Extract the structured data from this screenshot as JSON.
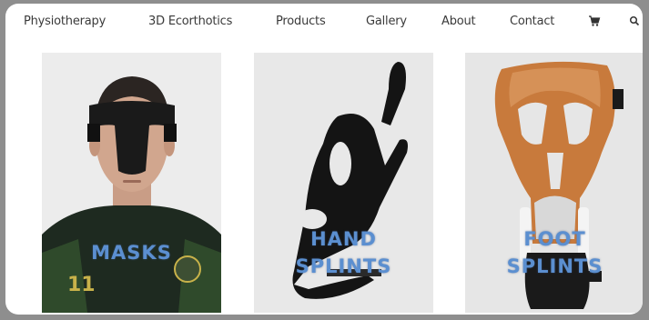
{
  "nav": {
    "items": [
      "Physiotherapy",
      "3D Ecorthotics",
      "Products",
      "Gallery",
      "About",
      "Contact"
    ],
    "cart_icon": "cart-icon",
    "search_icon": "search-icon"
  },
  "products": [
    {
      "line1": "MASKS",
      "line2": ""
    },
    {
      "line1": "HAND",
      "line2": "SPLINTS"
    },
    {
      "line1": "FOOT",
      "line2": "SPLINTS"
    }
  ],
  "colors": {
    "label": "#5b8fd0",
    "background": "#8e8e8e",
    "nav_text": "#3a3a3a",
    "foot_splint": "#c87a3c"
  }
}
